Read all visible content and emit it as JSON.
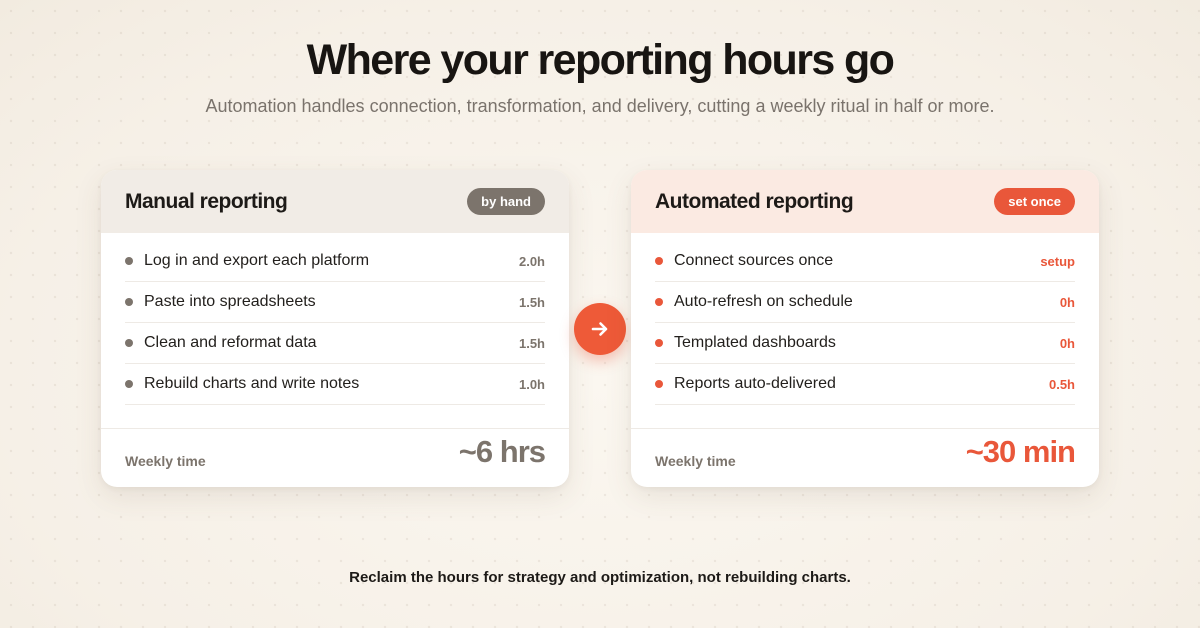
{
  "header": {
    "title": "Where your reporting hours go",
    "subtitle": "Automation handles connection, transformation, and delivery, cutting a weekly ritual in half or more."
  },
  "manual": {
    "title": "Manual reporting",
    "badge": "by hand",
    "rows": [
      {
        "label": "Log in and export each platform",
        "value": "2.0h"
      },
      {
        "label": "Paste into spreadsheets",
        "value": "1.5h"
      },
      {
        "label": "Clean and reformat data",
        "value": "1.5h"
      },
      {
        "label": "Rebuild charts and write notes",
        "value": "1.0h"
      }
    ],
    "footer_label": "Weekly time",
    "footer_value": "~6 hrs"
  },
  "automated": {
    "title": "Automated reporting",
    "badge": "set once",
    "rows": [
      {
        "label": "Connect sources once",
        "value": "setup"
      },
      {
        "label": "Auto-refresh on schedule",
        "value": "0h"
      },
      {
        "label": "Templated dashboards",
        "value": "0h"
      },
      {
        "label": "Reports auto-delivered",
        "value": "0.5h"
      }
    ],
    "footer_label": "Weekly time",
    "footer_value": "~30 min"
  },
  "arrow": {
    "icon": "arrow-right-icon",
    "color": "#ee5a38"
  },
  "caption": "Reclaim the hours for strategy and optimization, not rebuilding charts.",
  "colors": {
    "accent": "#e9573a",
    "neutral": "#7c746c",
    "background": "#f6f0e7"
  }
}
